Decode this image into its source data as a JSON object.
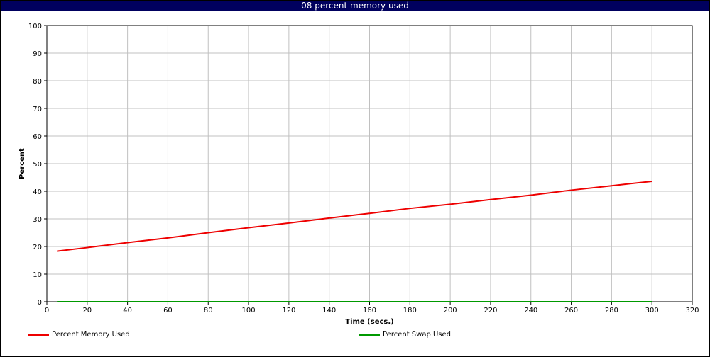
{
  "window": {
    "title": "08 percent memory used"
  },
  "colors": {
    "title_bg": "#00005e",
    "memory": "#ee0000",
    "swap": "#009900",
    "grid": "#c0c0c0"
  },
  "chart_data": {
    "type": "line",
    "title": "08 percent memory used",
    "xlabel": "Time (secs.)",
    "ylabel": "Percent",
    "xlim": [
      0,
      320
    ],
    "ylim": [
      0,
      100
    ],
    "xticks": [
      0,
      20,
      40,
      60,
      80,
      100,
      120,
      140,
      160,
      180,
      200,
      220,
      240,
      260,
      280,
      300,
      320
    ],
    "yticks": [
      0,
      10,
      20,
      30,
      40,
      50,
      60,
      70,
      80,
      90,
      100
    ],
    "grid": true,
    "legend": "bottom",
    "series": [
      {
        "name": "Percent Memory Used",
        "color": "#ee0000",
        "points": [
          [
            5,
            18.3
          ],
          [
            20,
            19.6
          ],
          [
            40,
            21.4
          ],
          [
            60,
            23.1
          ],
          [
            80,
            25.0
          ],
          [
            100,
            26.8
          ],
          [
            120,
            28.5
          ],
          [
            140,
            30.3
          ],
          [
            160,
            32.0
          ],
          [
            180,
            33.8
          ],
          [
            200,
            35.3
          ],
          [
            220,
            37.0
          ],
          [
            240,
            38.6
          ],
          [
            260,
            40.4
          ],
          [
            280,
            42.0
          ],
          [
            300,
            43.6
          ]
        ]
      },
      {
        "name": "Percent Swap Used",
        "color": "#009900",
        "points": [
          [
            5,
            0
          ],
          [
            50,
            0
          ],
          [
            100,
            0
          ],
          [
            150,
            0
          ],
          [
            200,
            0
          ],
          [
            250,
            0
          ],
          [
            300,
            0
          ]
        ]
      }
    ]
  }
}
